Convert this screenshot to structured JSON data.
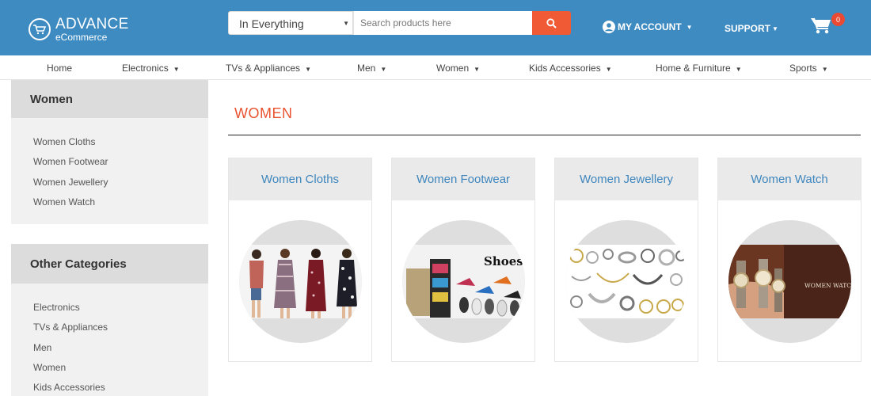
{
  "header": {
    "logo_title": "ADVANCE",
    "logo_subtitle": "eCommerce",
    "search_category": "In Everything",
    "search_placeholder": "Search products here",
    "account_label": "MY ACCOUNT",
    "support_label": "SUPPORT",
    "cart_count": "0",
    "brand_color": "#3e8bc2",
    "accent_color": "#f05a35"
  },
  "nav": {
    "items": [
      {
        "label": "Home",
        "has_dropdown": false
      },
      {
        "label": "Electronics",
        "has_dropdown": true
      },
      {
        "label": "TVs & Appliances",
        "has_dropdown": true
      },
      {
        "label": "Men",
        "has_dropdown": true
      },
      {
        "label": "Women",
        "has_dropdown": true
      },
      {
        "label": "Kids Accessories",
        "has_dropdown": true
      },
      {
        "label": "Home & Furniture",
        "has_dropdown": true
      },
      {
        "label": "Sports",
        "has_dropdown": true
      }
    ]
  },
  "sidebar": {
    "section1": {
      "title": "Women",
      "items": [
        "Women Cloths",
        "Women Footwear",
        "Women Jewellery",
        "Women Watch"
      ]
    },
    "section2": {
      "title": "Other Categories",
      "items": [
        "Electronics",
        "TVs & Appliances",
        "Men",
        "Women",
        "Kids Accessories"
      ]
    }
  },
  "main": {
    "title": "WOMEN",
    "cards": [
      {
        "title": "Women Cloths",
        "image": "women-cloths-photo"
      },
      {
        "title": "Women Footwear",
        "image": "women-footwear-photo",
        "image_text": "Shoes"
      },
      {
        "title": "Women Jewellery",
        "image": "women-jewellery-photo"
      },
      {
        "title": "Women Watch",
        "image": "women-watch-photo",
        "image_text": "WOMEN WATCHES"
      }
    ]
  }
}
